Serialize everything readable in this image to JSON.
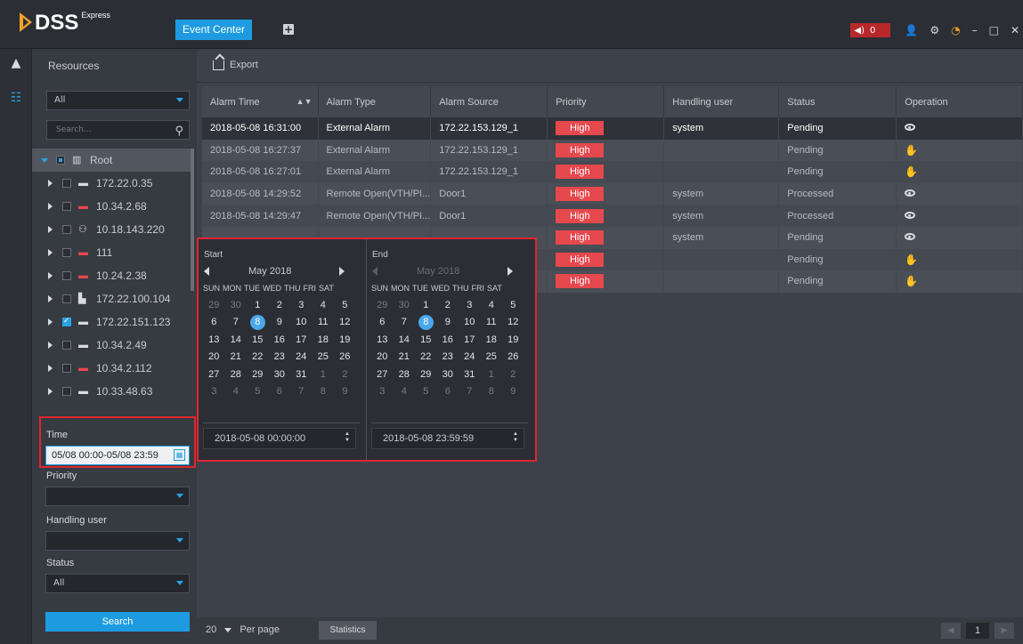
{
  "app": {
    "logo": "DSS",
    "logo_sup": "Express",
    "active_tab": "Event Center",
    "add_tab_icon": "plus-icon",
    "alarm_count": "0"
  },
  "strip": {
    "icons": [
      "warning-icon",
      "event-search-icon"
    ]
  },
  "left": {
    "header": "Resources",
    "filter_select": "All",
    "search_placeholder": "Search...",
    "tree": [
      {
        "label": "Root",
        "level": 0,
        "expanded": true,
        "check": "partial",
        "icon": "org-icon",
        "selected": true
      },
      {
        "label": "172.22.0.35",
        "level": 1,
        "check": "none",
        "icon": "nvr-icon"
      },
      {
        "label": "10.34.2.68",
        "level": 1,
        "check": "none",
        "icon": "nvr-red-icon"
      },
      {
        "label": "10.18.143.220",
        "level": 1,
        "check": "none",
        "icon": "access-icon"
      },
      {
        "label": "111",
        "level": 1,
        "check": "none",
        "icon": "nvr-red-icon"
      },
      {
        "label": "10.24.2.38",
        "level": 1,
        "check": "none",
        "icon": "nvr-red-icon"
      },
      {
        "label": "172.22.100.104",
        "level": 1,
        "check": "none",
        "icon": "vto-icon"
      },
      {
        "label": "172.22.151.123",
        "level": 1,
        "check": "checked",
        "icon": "nvr-icon"
      },
      {
        "label": "10.34.2.49",
        "level": 1,
        "check": "none",
        "icon": "nvr-icon"
      },
      {
        "label": "10.34.2.112",
        "level": 1,
        "check": "none",
        "icon": "nvr-red-icon"
      },
      {
        "label": "10.33.48.63",
        "level": 1,
        "check": "none",
        "icon": "nvr-icon"
      }
    ],
    "time_label": "Time",
    "time_value": "05/08 00:00-05/08 23:59",
    "priority_label": "Priority",
    "priority_value": "",
    "handling_label": "Handling user",
    "handling_value": "",
    "status_label": "Status",
    "status_value": "All",
    "search_button": "Search"
  },
  "toolbar": {
    "export_label": "Export"
  },
  "table": {
    "columns": [
      "Alarm Time",
      "Alarm Type",
      "Alarm Source",
      "Priority",
      "Handling user",
      "Status",
      "Operation"
    ],
    "rows": [
      {
        "time": "2018-05-08 16:31:00",
        "type": "External Alarm",
        "source": "172.22.153.129_1",
        "priority": "High",
        "user": "system",
        "status": "Pending",
        "op": "view-icon"
      },
      {
        "time": "2018-05-08 16:27:37",
        "type": "External Alarm",
        "source": "172.22.153.129_1",
        "priority": "High",
        "user": "",
        "status": "Pending",
        "op": "handle-icon"
      },
      {
        "time": "2018-05-08 16:27:01",
        "type": "External Alarm",
        "source": "172.22.153.129_1",
        "priority": "High",
        "user": "",
        "status": "Pending",
        "op": "handle-icon"
      },
      {
        "time": "2018-05-08 14:29:52",
        "type": "Remote Open(VTH/PI...",
        "source": "Door1",
        "priority": "High",
        "user": "system",
        "status": "Processed",
        "op": "view-icon"
      },
      {
        "time": "2018-05-08 14:29:47",
        "type": "Remote Open(VTH/PI...",
        "source": "Door1",
        "priority": "High",
        "user": "system",
        "status": "Processed",
        "op": "view-icon"
      },
      {
        "time": "",
        "type": "",
        "source": "",
        "priority": "High",
        "user": "system",
        "status": "Pending",
        "op": "view-icon"
      },
      {
        "time": "",
        "type": "",
        "source": "",
        "priority": "High",
        "user": "",
        "status": "Pending",
        "op": "handle-icon"
      },
      {
        "time": "",
        "type": "",
        "source": "",
        "priority": "High",
        "user": "",
        "status": "Pending",
        "op": "handle-icon"
      }
    ]
  },
  "calendar": {
    "start": {
      "title": "Start",
      "month": "May 2018",
      "dow": [
        "SUN",
        "MON",
        "TUE",
        "WED",
        "THU",
        "FRI",
        "SAT"
      ],
      "weeks": [
        [
          "29",
          "30",
          "1",
          "2",
          "3",
          "4",
          "5"
        ],
        [
          "6",
          "7",
          "8",
          "9",
          "10",
          "11",
          "12"
        ],
        [
          "13",
          "14",
          "15",
          "16",
          "17",
          "18",
          "19"
        ],
        [
          "20",
          "21",
          "22",
          "23",
          "24",
          "25",
          "26"
        ],
        [
          "27",
          "28",
          "29",
          "30",
          "31",
          "1",
          "2"
        ],
        [
          "3",
          "4",
          "5",
          "6",
          "7",
          "8",
          "9"
        ]
      ],
      "selected_day": "8",
      "time": "2018-05-08 00:00:00"
    },
    "end": {
      "title": "End",
      "month": "May 2018",
      "dow": [
        "SUN",
        "MON",
        "TUE",
        "WED",
        "THU",
        "FRI",
        "SAT"
      ],
      "weeks": [
        [
          "29",
          "30",
          "1",
          "2",
          "3",
          "4",
          "5"
        ],
        [
          "6",
          "7",
          "8",
          "9",
          "10",
          "11",
          "12"
        ],
        [
          "13",
          "14",
          "15",
          "16",
          "17",
          "18",
          "19"
        ],
        [
          "20",
          "21",
          "22",
          "23",
          "24",
          "25",
          "26"
        ],
        [
          "27",
          "28",
          "29",
          "30",
          "31",
          "1",
          "2"
        ],
        [
          "3",
          "4",
          "5",
          "6",
          "7",
          "8",
          "9"
        ]
      ],
      "selected_day": "8",
      "time": "2018-05-08 23:59:59"
    }
  },
  "pager": {
    "per_page_value": "20",
    "per_page_label": "Per page",
    "statistics": "Statistics",
    "page": "1"
  },
  "colors": {
    "accent": "#1e9be0",
    "high": "#e5484d",
    "highlight_border": "#e02530"
  }
}
